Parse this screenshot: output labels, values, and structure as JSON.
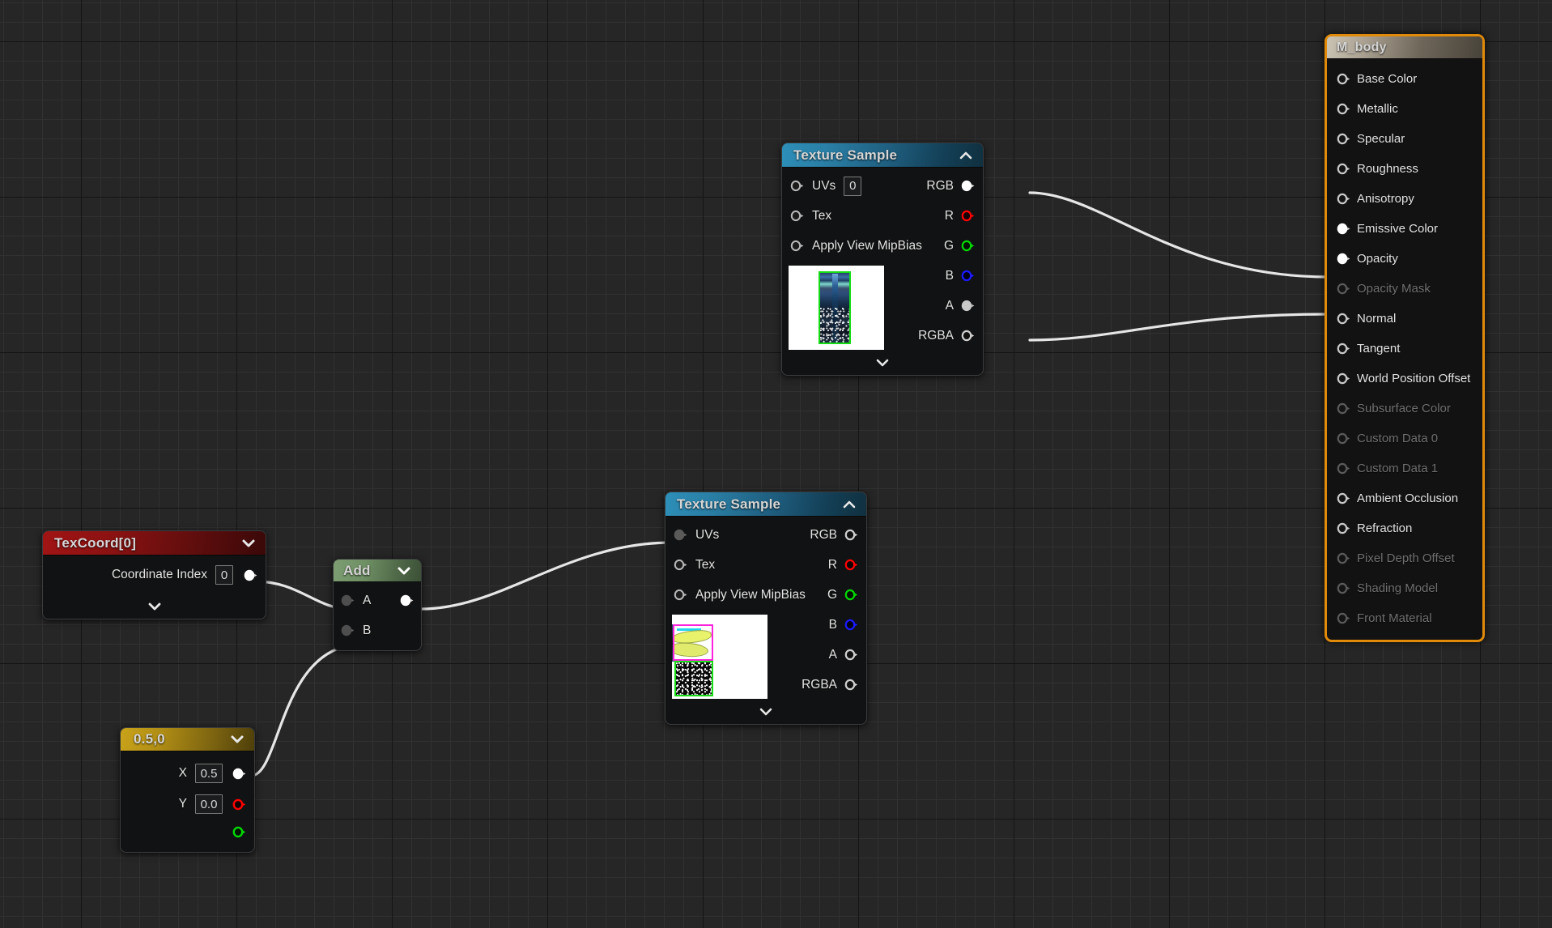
{
  "app": {
    "editor": "Unreal Engine Material Editor",
    "canvas_background": "#262626",
    "grid_minor_color": "#313131",
    "grid_major_color": "#141414",
    "wire_color": "#e6e6e6"
  },
  "nodes": {
    "texcoord": {
      "title": "TexCoord[0]",
      "header_color": "#a11414",
      "rows": [
        {
          "label": "Coordinate Index",
          "value": "0"
        }
      ]
    },
    "constant": {
      "title": "0.5,0",
      "header_color": "#c9a31a",
      "rows": [
        {
          "label": "X",
          "value": "0.5"
        },
        {
          "label": "Y",
          "value": "0.0"
        }
      ]
    },
    "add": {
      "title": "Add",
      "header_color": "#7d9d72",
      "inputs": [
        {
          "label": "A"
        },
        {
          "label": "B"
        }
      ],
      "outputs": [
        {
          "label": ""
        }
      ]
    },
    "texsample1": {
      "title": "Texture Sample",
      "header_color": "#2d8fb8",
      "inputs": [
        {
          "label": "UVs",
          "value": "0"
        },
        {
          "label": "Tex",
          "value": null
        },
        {
          "label": "Apply View MipBias",
          "value": null
        }
      ],
      "outputs": [
        {
          "label": "RGB",
          "color": "#ffffff",
          "connected": true
        },
        {
          "label": "R",
          "color": "#ff0000",
          "connected": false
        },
        {
          "label": "G",
          "color": "#00d900",
          "connected": false
        },
        {
          "label": "B",
          "color": "#1a1aff",
          "connected": false
        },
        {
          "label": "A",
          "color": "#cccccc",
          "connected": true
        },
        {
          "label": "RGBA",
          "color": "#cfcfcf",
          "connected": false
        }
      ]
    },
    "texsample2": {
      "title": "Texture Sample",
      "header_color": "#2d8fb8",
      "inputs": [
        {
          "label": "UVs",
          "value": null
        },
        {
          "label": "Tex",
          "value": null
        },
        {
          "label": "Apply View MipBias",
          "value": null
        }
      ],
      "outputs": [
        {
          "label": "RGB",
          "color": "#cfcfcf",
          "connected": false
        },
        {
          "label": "R",
          "color": "#ff0000",
          "connected": false
        },
        {
          "label": "G",
          "color": "#00d900",
          "connected": false
        },
        {
          "label": "B",
          "color": "#1a1aff",
          "connected": false
        },
        {
          "label": "A",
          "color": "#cfcfcf",
          "connected": false
        },
        {
          "label": "RGBA",
          "color": "#cfcfcf",
          "connected": false
        }
      ]
    },
    "material": {
      "title": "M_body",
      "border_color": "#e08a0a",
      "pins": [
        {
          "label": "Base Color",
          "enabled": true,
          "connected": false
        },
        {
          "label": "Metallic",
          "enabled": true,
          "connected": false
        },
        {
          "label": "Specular",
          "enabled": true,
          "connected": false
        },
        {
          "label": "Roughness",
          "enabled": true,
          "connected": false
        },
        {
          "label": "Anisotropy",
          "enabled": true,
          "connected": false
        },
        {
          "label": "Emissive Color",
          "enabled": true,
          "connected": true
        },
        {
          "label": "Opacity",
          "enabled": true,
          "connected": true
        },
        {
          "label": "Opacity Mask",
          "enabled": false,
          "connected": false
        },
        {
          "label": "Normal",
          "enabled": true,
          "connected": false
        },
        {
          "label": "Tangent",
          "enabled": true,
          "connected": false
        },
        {
          "label": "World Position Offset",
          "enabled": true,
          "connected": false
        },
        {
          "label": "Subsurface Color",
          "enabled": false,
          "connected": false
        },
        {
          "label": "Custom Data 0",
          "enabled": false,
          "connected": false
        },
        {
          "label": "Custom Data 1",
          "enabled": false,
          "connected": false
        },
        {
          "label": "Ambient Occlusion",
          "enabled": true,
          "connected": false
        },
        {
          "label": "Refraction",
          "enabled": true,
          "connected": false
        },
        {
          "label": "Pixel Depth Offset",
          "enabled": false,
          "connected": false
        },
        {
          "label": "Shading Model",
          "enabled": false,
          "connected": false
        },
        {
          "label": "Front Material",
          "enabled": false,
          "connected": false
        }
      ]
    }
  },
  "connections": [
    {
      "from": "texsample1.RGB",
      "to": "material.Emissive Color"
    },
    {
      "from": "texsample1.A",
      "to": "material.Opacity"
    },
    {
      "from": "texcoord.out",
      "to": "add.A"
    },
    {
      "from": "constant.out",
      "to": "add.B"
    },
    {
      "from": "add.out",
      "to": "texsample2.UVs"
    }
  ]
}
